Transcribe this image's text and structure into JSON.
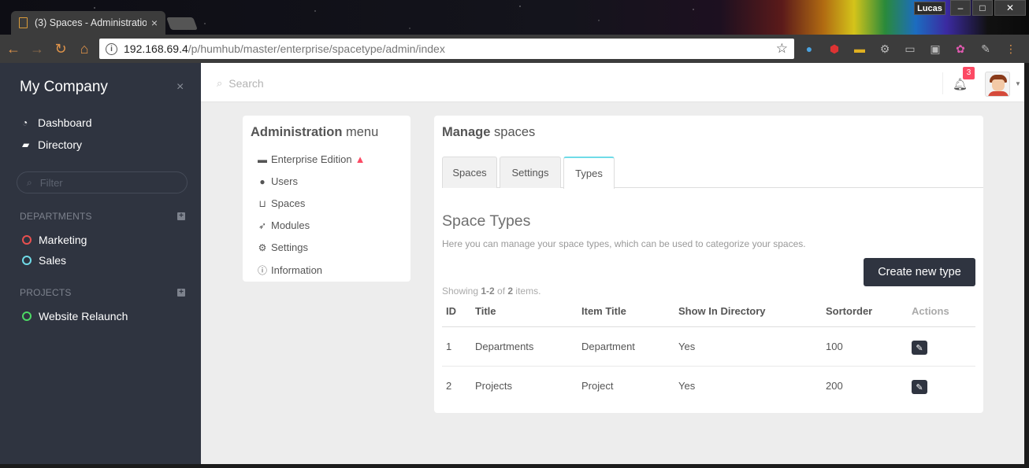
{
  "browser": {
    "tab_title": "(3) Spaces - Administratio",
    "tab_close": "×",
    "user_name": "Lucas",
    "window_buttons": [
      "–",
      "□",
      "✕"
    ],
    "url_host": "192.168.69.4",
    "url_path": "/p/humhub/master/enterprise/spacetype/admin/index",
    "icons": [
      "back-icon",
      "forward-icon",
      "reload-icon",
      "home-icon",
      "info-icon",
      "star-icon",
      "extension-icons",
      "menu-icon"
    ]
  },
  "sidebar": {
    "brand": "My Company",
    "close": "×",
    "links": [
      {
        "label": "Dashboard",
        "icon": "dashboard-icon"
      },
      {
        "label": "Directory",
        "icon": "book-icon"
      }
    ],
    "filter_placeholder": "Filter",
    "sections": [
      {
        "title": "DEPARTMENTS",
        "items": [
          {
            "label": "Marketing",
            "color": "#e8504f"
          },
          {
            "label": "Sales",
            "color": "#6fdbe8"
          }
        ]
      },
      {
        "title": "PROJECTS",
        "items": [
          {
            "label": "Website Relaunch",
            "color": "#4cd964"
          }
        ]
      }
    ]
  },
  "topbar": {
    "search_placeholder": "Search",
    "notification_count": "3"
  },
  "admin_menu": {
    "title_bold": "Administration",
    "title_rest": "menu",
    "items": [
      {
        "label": "Enterprise Edition",
        "icon": "briefcase-icon",
        "warning": true
      },
      {
        "label": "Users",
        "icon": "user-icon"
      },
      {
        "label": "Spaces",
        "icon": "inbox-icon"
      },
      {
        "label": "Modules",
        "icon": "rocket-icon"
      },
      {
        "label": "Settings",
        "icon": "cogs-icon"
      },
      {
        "label": "Information",
        "icon": "info-circle-icon"
      }
    ]
  },
  "manage": {
    "title_bold": "Manage",
    "title_rest": "spaces",
    "tabs": [
      "Spaces",
      "Settings",
      "Types"
    ],
    "active_tab": "Types",
    "heading": "Space Types",
    "description": "Here you can manage your space types, which can be used to categorize your spaces.",
    "create_button": "Create new type",
    "summary_prefix": "Showing ",
    "summary_range": "1-2",
    "summary_mid": " of ",
    "summary_total": "2",
    "summary_suffix": " items.",
    "columns": [
      "ID",
      "Title",
      "Item Title",
      "Show In Directory",
      "Sortorder",
      "Actions"
    ],
    "rows": [
      {
        "id": "1",
        "title": "Departments",
        "item_title": "Department",
        "show_in_directory": "Yes",
        "sortorder": "100"
      },
      {
        "id": "2",
        "title": "Projects",
        "item_title": "Project",
        "show_in_directory": "Yes",
        "sortorder": "200"
      }
    ]
  },
  "colors": {
    "sidebar_bg": "#2f3440",
    "accent": "#6fdbe8",
    "danger": "#fc4a64",
    "button_dark": "#2f3440"
  }
}
